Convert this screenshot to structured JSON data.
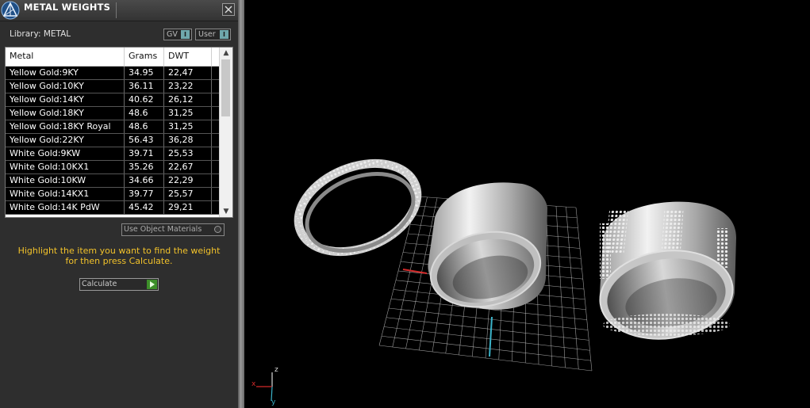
{
  "window": {
    "title": "METAL WEIGHTS",
    "close_symbol": "✕"
  },
  "library": {
    "label": "Library: METAL",
    "toggles": [
      {
        "label": "GV",
        "state": "I"
      },
      {
        "label": "User",
        "state": "I"
      }
    ]
  },
  "table": {
    "columns": [
      "Metal",
      "Grams",
      "DWT"
    ],
    "rows": [
      [
        "Yellow Gold:9KY",
        "34.95",
        "22,47"
      ],
      [
        "Yellow Gold:10KY",
        "36.11",
        "23,22"
      ],
      [
        "Yellow Gold:14KY",
        "40.62",
        "26,12"
      ],
      [
        "Yellow Gold:18KY",
        "48.6",
        "31,25"
      ],
      [
        "Yellow Gold:18KY Royal",
        "48.6",
        "31,25"
      ],
      [
        "Yellow Gold:22KY",
        "56.43",
        "36,28"
      ],
      [
        "White Gold:9KW",
        "39.71",
        "25,53"
      ],
      [
        "White Gold:10KX1",
        "35.26",
        "22,67"
      ],
      [
        "White Gold:10KW",
        "34.66",
        "22,29"
      ],
      [
        "White Gold:14KX1",
        "39.77",
        "25,57"
      ],
      [
        "White Gold:14K PdW",
        "45.42",
        "29,21"
      ]
    ],
    "scroll_position": 0.0
  },
  "use_object_materials": {
    "label": "Use Object Materials"
  },
  "instruction": {
    "line1": "Highlight the item you want to find the weight",
    "line2": "for then press Calculate."
  },
  "calculate": {
    "label": "Calculate"
  },
  "viewport": {
    "axis_labels": {
      "x": "x",
      "y": "y",
      "z": "z"
    },
    "colors": {
      "grid": "#cfcfcf",
      "x_axis": "#d42a2a",
      "y_axis": "#3bb3c9",
      "z_axis": "#d8d8d8",
      "highlight": "#f2c22a"
    }
  }
}
